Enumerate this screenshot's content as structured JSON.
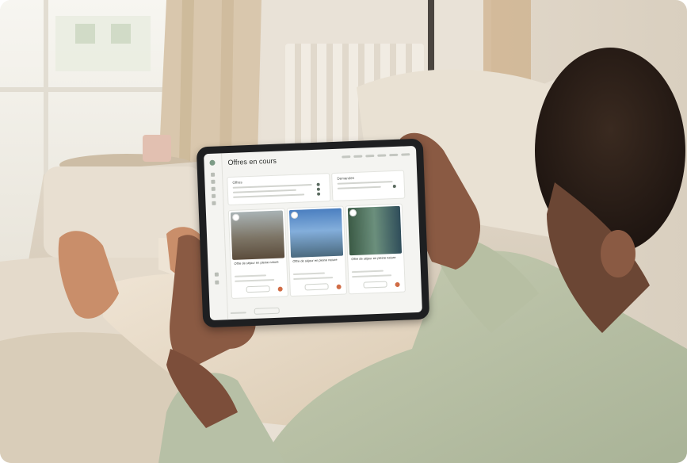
{
  "scene": {
    "description_tags": [
      "living-room",
      "sofa",
      "tablet",
      "person",
      "radiator",
      "window"
    ]
  },
  "tablet_app": {
    "title": "Offres en cours",
    "nav_items": [
      "",
      "",
      "",
      "",
      "",
      ""
    ],
    "filters": [
      {
        "label": "Offres"
      },
      {
        "label": "Demandes"
      }
    ],
    "cards": [
      {
        "title": "Offre de séjour en pleine nature"
      },
      {
        "title": "Offre de séjour en pleine nature"
      },
      {
        "title": "Offre de séjour en pleine nature"
      }
    ]
  },
  "colors": {
    "accent_green": "#7c9b86",
    "accent_orange": "#d06c45"
  }
}
